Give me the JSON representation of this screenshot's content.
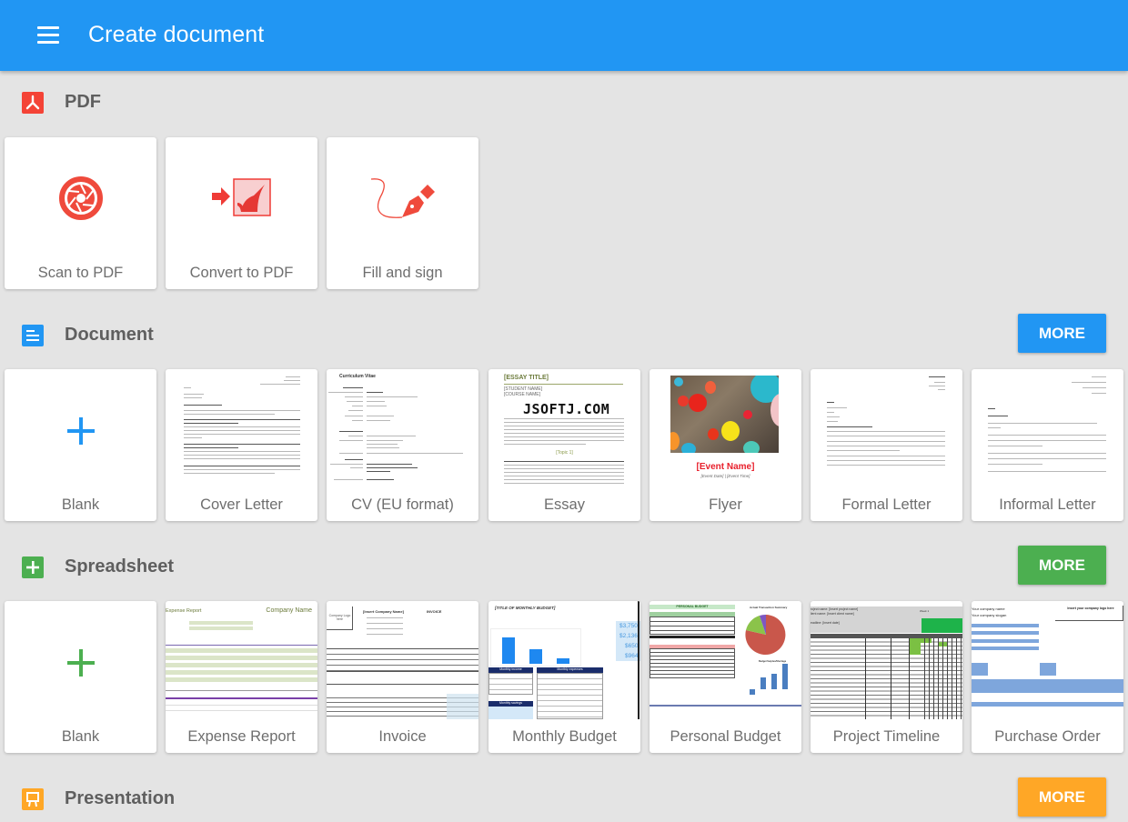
{
  "app": {
    "title": "Create document",
    "menu_icon": "hamburger-menu-icon"
  },
  "watermark": "JSOFTJ.COM",
  "sections": {
    "pdf": {
      "title": "PDF",
      "icon": "pdf-icon",
      "accent": "#f44336",
      "items": [
        {
          "label": "Scan to PDF",
          "icon": "camera-shutter-icon"
        },
        {
          "label": "Convert to PDF",
          "icon": "convert-to-pdf-icon"
        },
        {
          "label": "Fill and sign",
          "icon": "pen-signature-icon"
        }
      ]
    },
    "document": {
      "title": "Document",
      "icon": "document-icon",
      "accent": "#2196f3",
      "more_label": "MORE",
      "items": [
        {
          "label": "Blank"
        },
        {
          "label": "Cover Letter"
        },
        {
          "label": "CV (EU format)",
          "thumb_title": "Curriculum Vitae"
        },
        {
          "label": "Essay",
          "thumb_title": "[ESSAY TITLE]",
          "thumb_lines": [
            "[STUDENT NAME]",
            "[COURSE NAME]"
          ],
          "thumb_topic": "[Topic 1]"
        },
        {
          "label": "Flyer",
          "thumb_title": "[Event Name]",
          "thumb_sub": "[Event Date] | [Event Time]"
        },
        {
          "label": "Formal Letter"
        },
        {
          "label": "Informal Letter"
        }
      ]
    },
    "spreadsheet": {
      "title": "Spreadsheet",
      "icon": "spreadsheet-icon",
      "accent": "#4caf50",
      "more_label": "MORE",
      "items": [
        {
          "label": "Blank"
        },
        {
          "label": "Expense Report",
          "thumb_title": "Expense Report",
          "thumb_company": "Company Name"
        },
        {
          "label": "Invoice",
          "thumb_company": "[Insert Company Name]",
          "thumb_invoice": "INVOICE",
          "thumb_logo": "Company Logo here"
        },
        {
          "label": "Monthly Budget",
          "thumb_title": "[TITLE OF MONTHLY BUDGET]",
          "thumb_values": [
            "$3,750",
            "$2,136",
            "$650",
            "$964"
          ],
          "thumb_tables": [
            "Monthly income",
            "Monthly expenses",
            "Monthly savings"
          ]
        },
        {
          "label": "Personal Budget",
          "thumb_title": "PERSONAL BUDGET",
          "thumb_chart1": "Actual Transaction Summary",
          "thumb_chart2": "Budget Surplus/Shortage"
        },
        {
          "label": "Project Timeline",
          "thumb_lines": [
            "roject name: [Insert project name]",
            "lient name: [Insert client name]",
            "eadline: [Insert date]"
          ],
          "thumb_week": "Week 1"
        },
        {
          "label": "Purchase Order",
          "thumb_lines": [
            "Your company name",
            "Your company slogan"
          ],
          "thumb_logo": "Insert your company logo here"
        }
      ]
    },
    "presentation": {
      "title": "Presentation",
      "icon": "presentation-icon",
      "accent": "#ffa726",
      "more_label": "MORE"
    }
  }
}
